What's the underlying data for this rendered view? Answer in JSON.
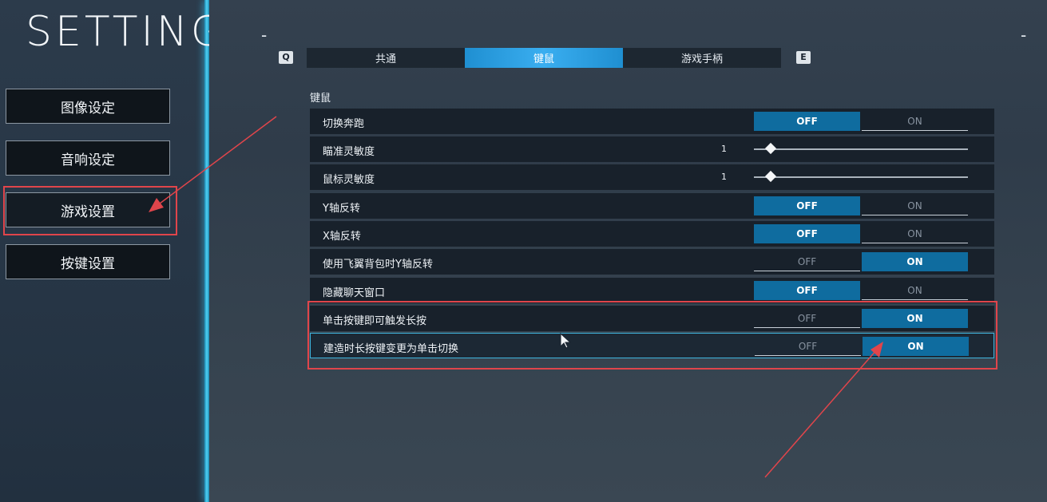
{
  "title": "SETTINGS",
  "sidebar": {
    "items": [
      {
        "label": "图像设定"
      },
      {
        "label": "音响设定"
      },
      {
        "label": "游戏设置"
      },
      {
        "label": "按键设置"
      }
    ]
  },
  "tabs": {
    "prev_key": "Q",
    "next_key": "E",
    "items": [
      {
        "label": "共通"
      },
      {
        "label": "键鼠"
      },
      {
        "label": "游戏手柄"
      }
    ],
    "active": "键鼠"
  },
  "section": {
    "label": "键鼠"
  },
  "options": {
    "off_label": "OFF",
    "on_label": "ON"
  },
  "rows": [
    {
      "label": "切换奔跑",
      "type": "toggle",
      "value": "OFF"
    },
    {
      "label": "瞄准灵敏度",
      "type": "slider",
      "value": "1"
    },
    {
      "label": "鼠标灵敏度",
      "type": "slider",
      "value": "1"
    },
    {
      "label": "Y轴反转",
      "type": "toggle",
      "value": "OFF"
    },
    {
      "label": "X轴反转",
      "type": "toggle",
      "value": "OFF"
    },
    {
      "label": "使用飞翼背包时Y轴反转",
      "type": "toggle",
      "value": "ON"
    },
    {
      "label": "隐藏聊天窗口",
      "type": "toggle",
      "value": "OFF"
    },
    {
      "label": "单击按键即可触发长按",
      "type": "toggle",
      "value": "ON"
    },
    {
      "label": "建造时长按键变更为单击切换",
      "type": "toggle",
      "value": "ON"
    }
  ],
  "colors": {
    "accent": "#0f6c9f",
    "annotation": "#e0454b",
    "tab_active": "#3aaef0"
  }
}
